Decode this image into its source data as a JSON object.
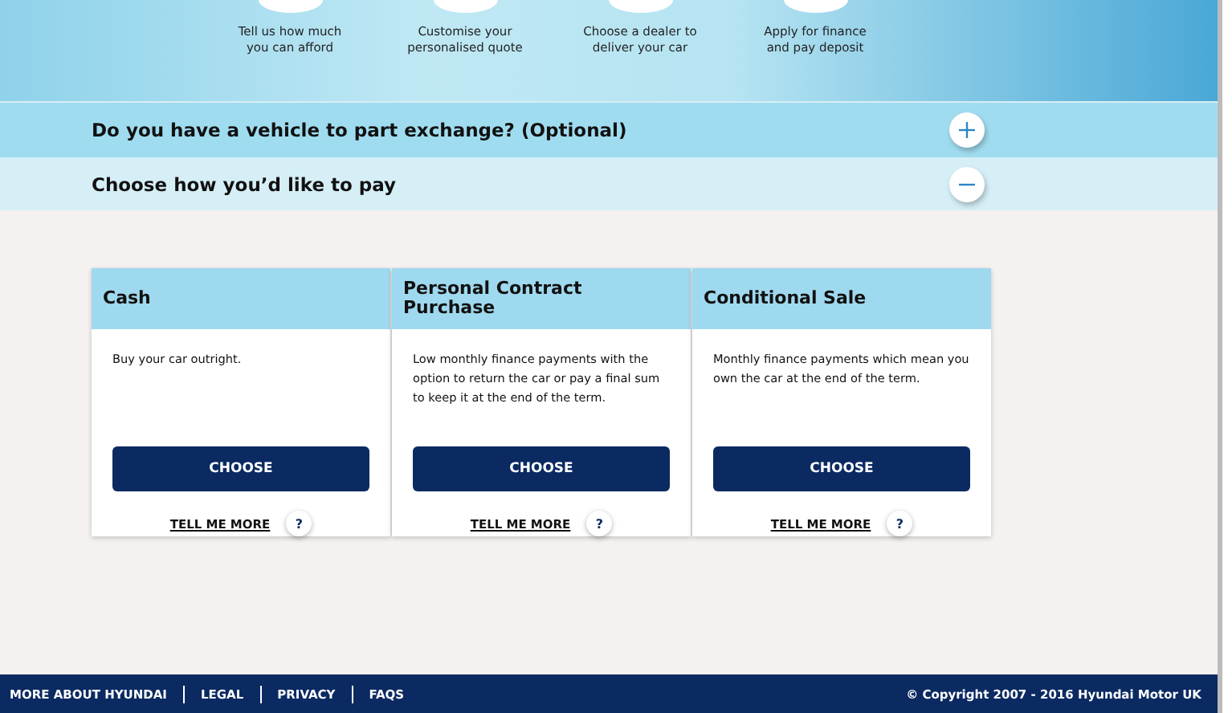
{
  "steps": [
    {
      "label": "Tell us how much\nyou can afford"
    },
    {
      "label": "Customise your\npersonalised quote"
    },
    {
      "label": "Choose a dealer to\ndeliver your car"
    },
    {
      "label": "Apply for finance\nand pay deposit"
    }
  ],
  "sections": [
    {
      "title": "Do you have a vehicle to part exchange? (Optional)",
      "expanded": false
    },
    {
      "title": "Choose how you’d like to pay",
      "expanded": true
    }
  ],
  "payment_options": [
    {
      "title": "Cash",
      "description": "Buy your car outright.",
      "button": "CHOOSE",
      "link": "TELL ME MORE",
      "help": "?"
    },
    {
      "title": "Personal Contract Purchase",
      "description": "Low monthly finance payments with the option to return the car or pay a final sum to keep it at the end of the term.",
      "button": "CHOOSE",
      "link": "TELL ME MORE",
      "help": "?"
    },
    {
      "title": "Conditional Sale",
      "description": "Monthly finance payments which mean you own the car at the end of the term.",
      "button": "CHOOSE",
      "link": "TELL ME MORE",
      "help": "?"
    }
  ],
  "footer": {
    "links": [
      "MORE ABOUT HYUNDAI",
      "LEGAL",
      "PRIVACY",
      "FAQS"
    ],
    "copyright": "© Copyright 2007 - 2016 Hyundai Motor UK"
  }
}
